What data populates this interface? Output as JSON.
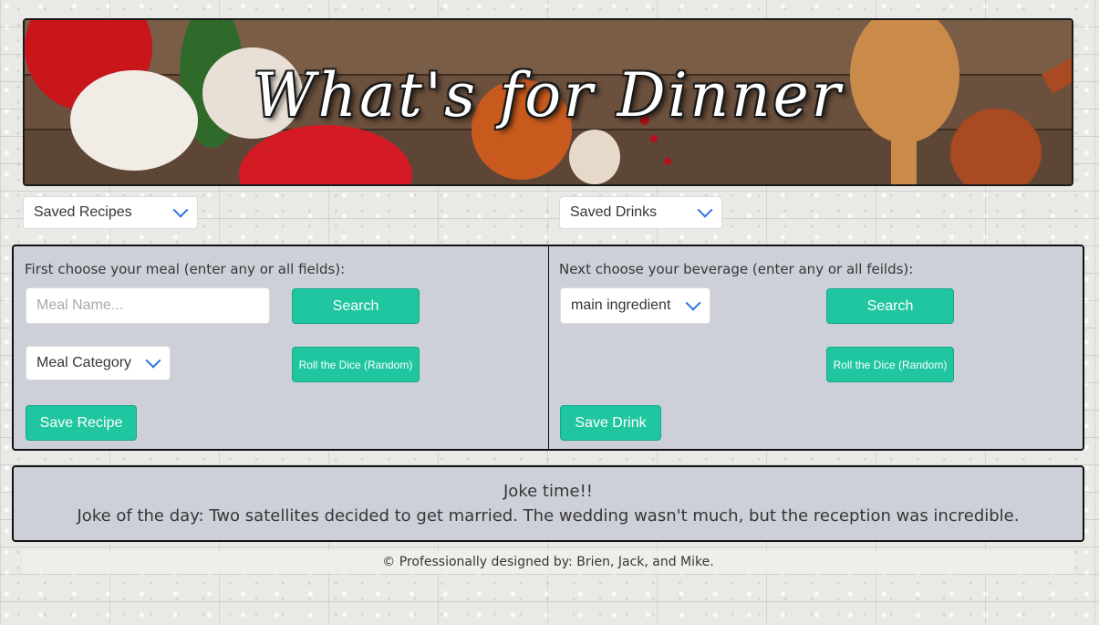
{
  "banner": {
    "title": "What's for Dinner"
  },
  "saved": {
    "recipes_label": "Saved Recipes",
    "drinks_label": "Saved Drinks"
  },
  "meal": {
    "instruction": "First choose your meal (enter any or all fields):",
    "name_placeholder": "Meal Name...",
    "search_label": "Search",
    "category_label": "Meal Category",
    "random_label": "Roll the Dice (Random)",
    "save_label": "Save Recipe"
  },
  "drink": {
    "instruction": "Next choose your beverage (enter any or all feilds):",
    "ingredient_label": "main ingredient",
    "search_label": "Search",
    "random_label": "Roll the Dice (Random)",
    "save_label": "Save Drink"
  },
  "joke": {
    "title": "Joke time!!",
    "text": "Joke of the day: Two satellites decided to get married. The wedding wasn't much, but the reception was incredible."
  },
  "footer": {
    "text": "© Professionally designed by: Brien, Jack, and Mike."
  },
  "colors": {
    "accent": "#1fc6a0",
    "panel_bg": "#cdd0d8",
    "chevron": "#3273dc"
  }
}
